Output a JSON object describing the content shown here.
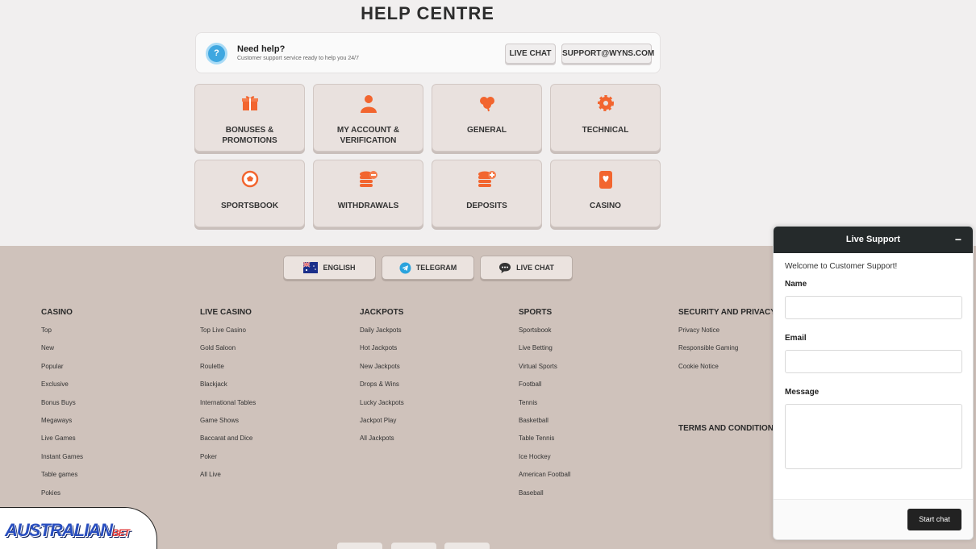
{
  "help": {
    "title": "HELP CENTRE",
    "need_title": "Need help?",
    "need_sub": "Customer support service ready to help you 24/7",
    "live_chat": "LIVE CHAT",
    "email": "SUPPORT@WYNS.COM"
  },
  "tiles": [
    {
      "label": "BONUSES & PROMOTIONS",
      "icon": "gift-icon"
    },
    {
      "label": "MY ACCOUNT & VERIFICATION",
      "icon": "user-icon"
    },
    {
      "label": "GENERAL",
      "icon": "clover-icon"
    },
    {
      "label": "TECHNICAL",
      "icon": "gear-icon"
    },
    {
      "label": "SPORTSBOOK",
      "icon": "ball-icon"
    },
    {
      "label": "WITHDRAWALS",
      "icon": "coins-minus-icon"
    },
    {
      "label": "DEPOSITS",
      "icon": "coins-plus-icon"
    },
    {
      "label": "CASINO",
      "icon": "card-icon"
    }
  ],
  "footer": {
    "pills": {
      "english": "ENGLISH",
      "telegram": "TELEGRAM",
      "live_chat": "LIVE CHAT"
    },
    "columns": [
      {
        "heading": "CASINO",
        "links": [
          "Top",
          "New",
          "Popular",
          "Exclusive",
          "Bonus Buys",
          "Megaways",
          "Live Games",
          "Instant Games",
          "Table games",
          "Pokies"
        ]
      },
      {
        "heading": "LIVE CASINO",
        "links": [
          "Top Live Casino",
          "Gold Saloon",
          "Roulette",
          "Blackjack",
          "International Tables",
          "Game Shows",
          "Baccarat and Dice",
          "Poker",
          "All Live"
        ]
      },
      {
        "heading": "JACKPOTS",
        "links": [
          "Daily Jackpots",
          "Hot Jackpots",
          "New Jackpots",
          "Drops & Wins",
          "Lucky Jackpots",
          "Jackpot Play",
          "All Jackpots"
        ]
      },
      {
        "heading": "SPORTS",
        "links": [
          "Sportsbook",
          "Live Betting",
          "Virtual Sports",
          "Football",
          "Tennis",
          "Basketball",
          "Table Tennis",
          "Ice Hockey",
          "American Football",
          "Baseball"
        ]
      },
      {
        "heading": "SECURITY AND PRIVACY",
        "links": [
          "Privacy Notice",
          "Responsible Gaming",
          "Cookie Notice"
        ]
      }
    ],
    "terms": "TERMS AND CONDITIONS"
  },
  "logo": {
    "main": "AUSTRALIAN",
    "suffix": "BET"
  },
  "chat": {
    "title": "Live Support",
    "minimize": "−",
    "welcome": "Welcome to Customer Support!",
    "name_label": "Name",
    "email_label": "Email",
    "message_label": "Message",
    "start": "Start chat"
  },
  "colors": {
    "accent": "#f2652f",
    "footer_bg": "#cfc2bb",
    "chat_header": "#252a2b"
  }
}
